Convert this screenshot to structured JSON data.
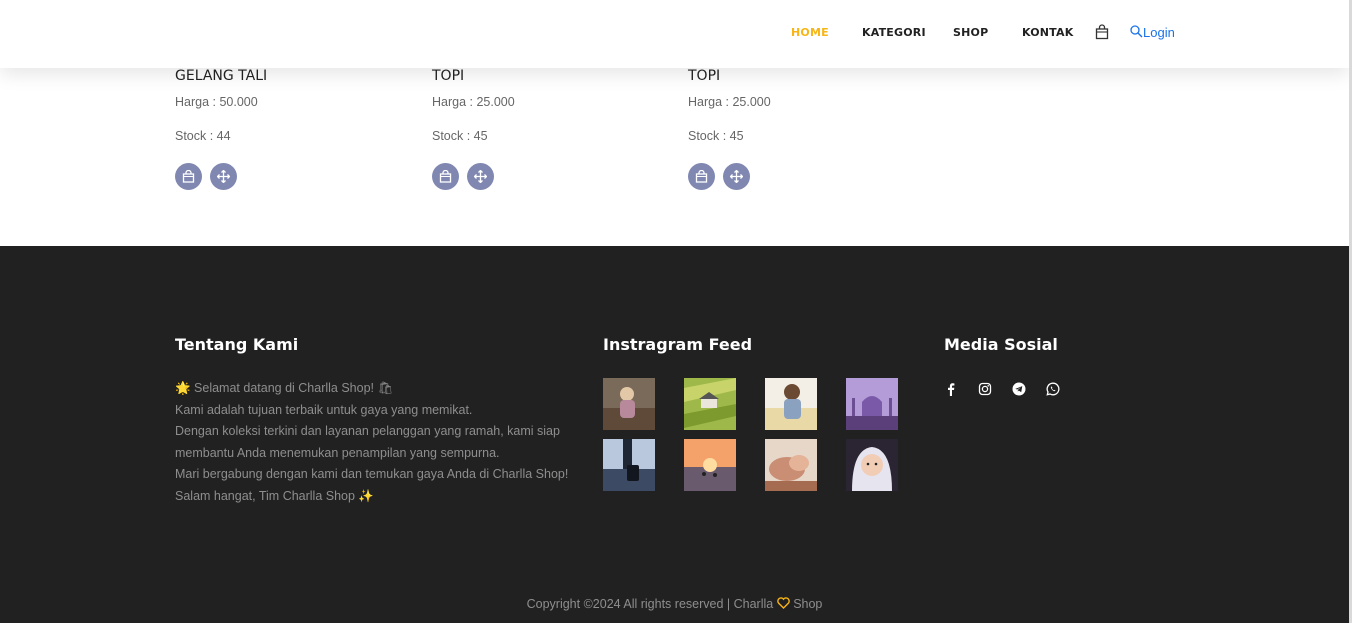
{
  "nav": {
    "items": [
      {
        "label": "HOME",
        "active": true
      },
      {
        "label": "KATEGORI",
        "active": false
      },
      {
        "label": "SHOP",
        "active": false
      },
      {
        "label": "KONTAK",
        "active": false
      }
    ],
    "login_label": "Login",
    "cart_icon": "shopping-bag-icon",
    "search_icon": "search-icon"
  },
  "products": [
    {
      "name": "GELANG TALI",
      "price": "Harga : 50.000",
      "stock": "Stock : 44"
    },
    {
      "name": "TOPI",
      "price": "Harga : 25.000",
      "stock": "Stock : 45"
    },
    {
      "name": "TOPI",
      "price": "Harga : 25.000",
      "stock": "Stock : 45"
    }
  ],
  "footer": {
    "about": {
      "heading": "Tentang Kami",
      "lines": [
        "🌟 Selamat datang di Charlla Shop! 🛍",
        "Kami adalah tujuan terbaik untuk gaya yang memikat.",
        "Dengan koleksi terkini dan layanan pelanggan yang ramah, kami siap membantu Anda menemukan penampilan yang sempurna.",
        "Mari bergabung dengan kami dan temukan gaya Anda di Charlla Shop!",
        "Salam hangat, Tim Charlla Shop ✨"
      ]
    },
    "instagram": {
      "heading": "Instragram Feed"
    },
    "social": {
      "heading": "Media Sosial",
      "icons": [
        "facebook-icon",
        "instagram-icon",
        "telegram-icon",
        "whatsapp-icon"
      ]
    },
    "copyright_prefix": "Copyright ©2024 All rights reserved | Charlla",
    "copyright_suffix": "Shop"
  },
  "colors": {
    "accent": "#f7b516",
    "link": "#1a73e8",
    "button": "#8088b2",
    "footer_bg": "#212122"
  }
}
